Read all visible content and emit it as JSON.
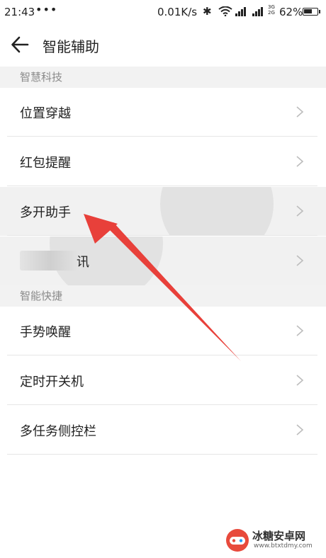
{
  "status_bar": {
    "time": "21:43",
    "dots": "•••",
    "speed": "0.01K/s",
    "network_top": "3G",
    "network_bottom": "2G",
    "battery_percent": "62%",
    "battery_level": 0.62
  },
  "header": {
    "title": "智能辅助"
  },
  "sections": [
    {
      "title": "智慧科技",
      "items": [
        "位置穿越",
        "红包提醒",
        "多开助手"
      ],
      "obscured_tail": "讯"
    },
    {
      "title": "智能快捷",
      "items": [
        "手势唤醒",
        "定时开关机",
        "多任务侧控栏"
      ]
    }
  ],
  "watermark": {
    "title": "冰糖安卓网",
    "url": "www.btxtdmy.com"
  },
  "colors": {
    "arrow": "#e8403a",
    "section_bg": "#f2f2f2",
    "pressed_bg": "#f1f1f1"
  }
}
